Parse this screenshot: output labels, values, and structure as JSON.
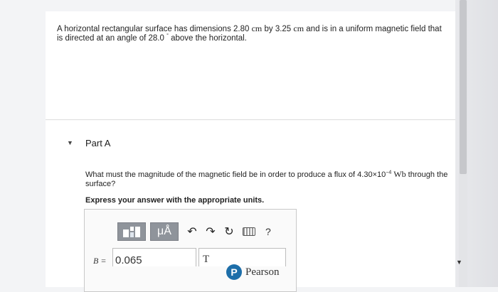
{
  "problem": {
    "text_a": "A horizontal rectangular surface has dimensions 2.80 ",
    "unit_cm_1": "cm",
    "text_b": " by 3.25 ",
    "unit_cm_2": "cm",
    "text_c": " and is in a uniform magnetic field that is directed at an angle of 28.0 ",
    "degree": "°",
    "text_d": " above the horizontal."
  },
  "part": {
    "caret": "▼",
    "title": "Part A"
  },
  "question": {
    "text_a": "What must the magnitude of the magnetic field be in order to produce a flux of 4.30×10",
    "exponent": "−4",
    "unit_wb": "Wb",
    "text_b": " through the surface?"
  },
  "instruction": "Express your answer with the appropriate units.",
  "toolbar": {
    "templates_icon": "templates-icon",
    "units_button_label": "μÅ",
    "undo_icon": "↶",
    "redo_icon": "↷",
    "reset_icon": "↻",
    "keyboard_icon": "keyboard-icon",
    "help_icon": "?"
  },
  "answer": {
    "label": "B =",
    "value": "0.065",
    "units": "T"
  },
  "brand": {
    "logo_letter": "P",
    "name": "Pearson",
    "color": "#1d6ea9"
  },
  "scroll_down_icon": "▼"
}
